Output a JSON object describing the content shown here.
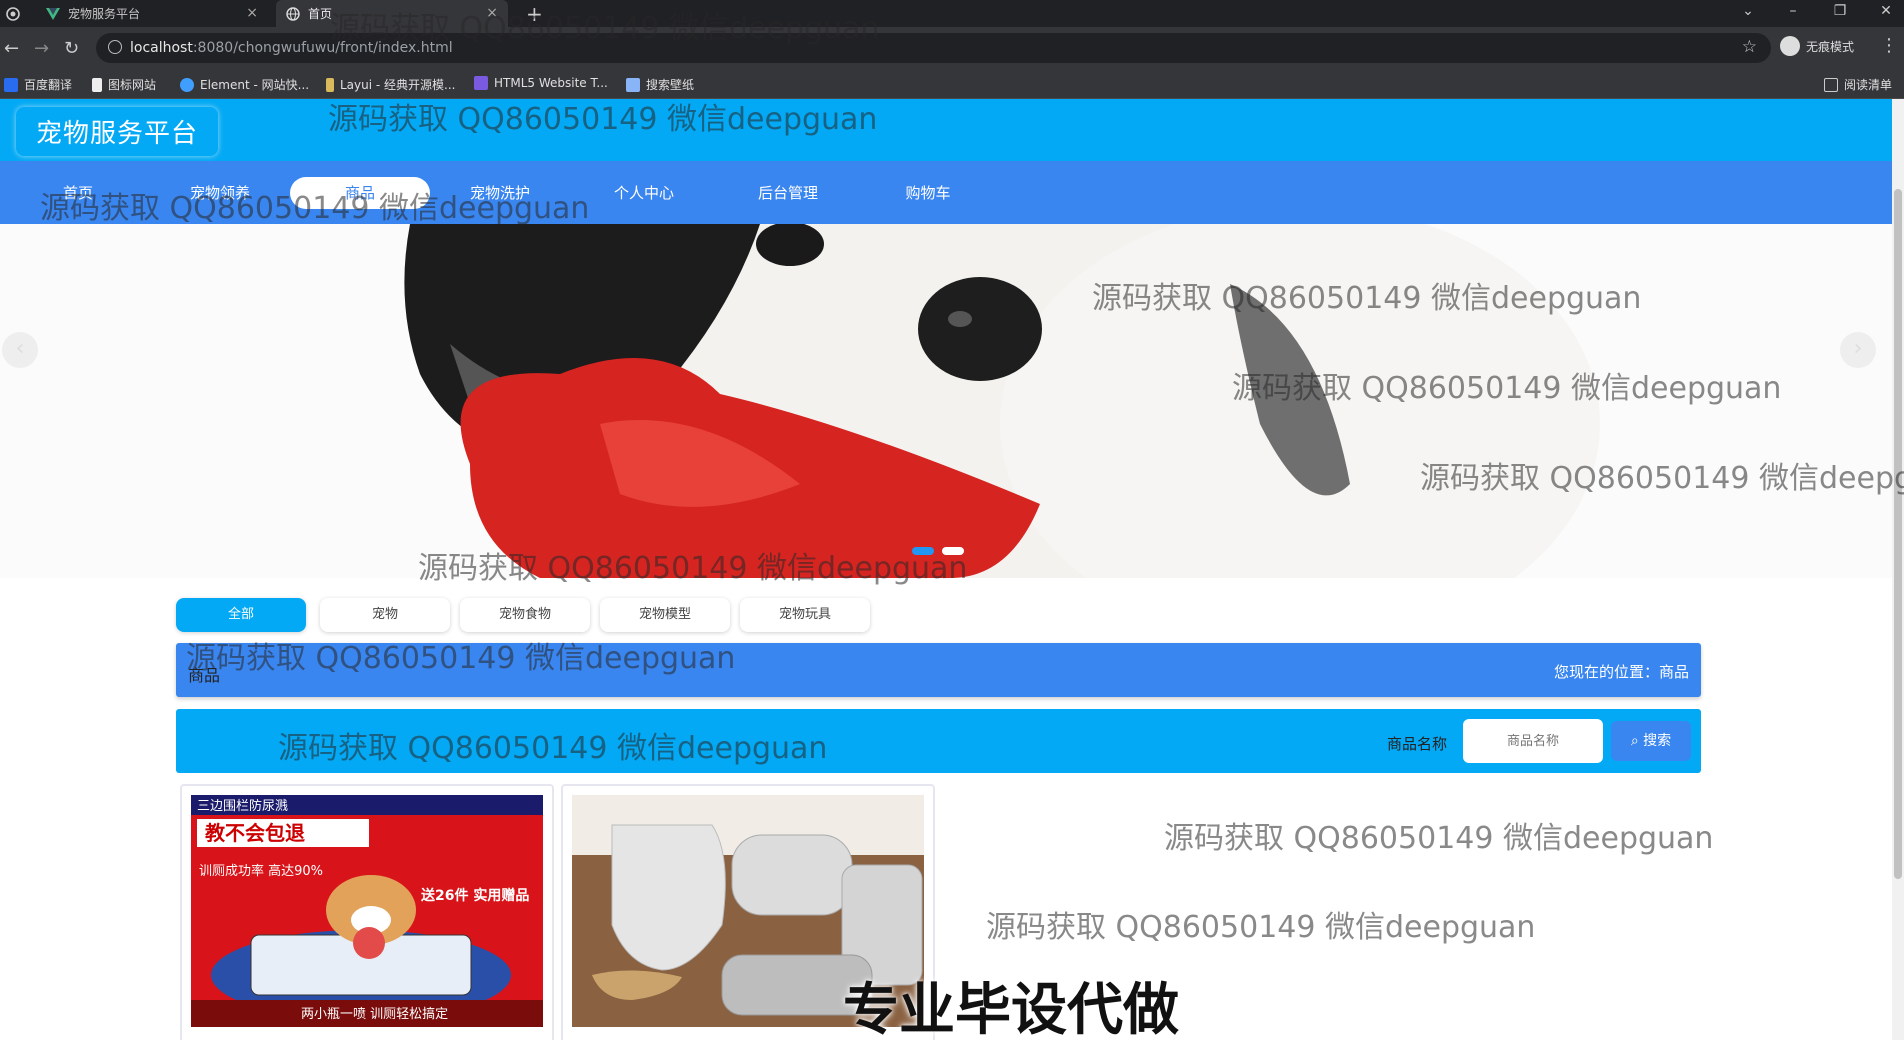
{
  "browser": {
    "tabs": [
      {
        "title": "宠物服务平台",
        "active": false
      },
      {
        "title": "首页",
        "active": true
      }
    ],
    "url_host": "localhost",
    "url_rest": ":8080/chongwufuwu/front/index.html",
    "profile_label": "无痕模式",
    "reading_list": "阅读清单",
    "bookmarks": [
      "百度翻译",
      "图标网站",
      "Element - 网站快...",
      "Layui - 经典开源模...",
      "HTML5 Website T...",
      "搜索壁纸"
    ]
  },
  "site": {
    "logo": "宠物服务平台",
    "nav": [
      {
        "label": "首页",
        "active": false
      },
      {
        "label": "宠物领养",
        "active": false
      },
      {
        "label": "商品",
        "active": true
      },
      {
        "label": "宠物洗护",
        "active": false
      },
      {
        "label": "个人中心",
        "active": false
      },
      {
        "label": "后台管理",
        "active": false
      },
      {
        "label": "购物车",
        "active": false
      }
    ],
    "banner_slide": 1,
    "banner_slide_count": 2
  },
  "categories": [
    {
      "label": "全部",
      "active": true
    },
    {
      "label": "宠物",
      "active": false
    },
    {
      "label": "宠物食物",
      "active": false
    },
    {
      "label": "宠物模型",
      "active": false
    },
    {
      "label": "宠物玩具",
      "active": false
    }
  ],
  "breadcrumb": {
    "title": "商品",
    "location": "您现在的位置：商品"
  },
  "search": {
    "label": "商品名称",
    "placeholder": "商品名称",
    "button": "搜索"
  },
  "products": [
    {
      "image_text": [
        "三边围栏防尿溅",
        "教不会包退",
        "训厕成功率 高达90%",
        "送26件 实用赠品",
        "两小瓶一喷 训厕轻松搞定"
      ]
    },
    {
      "image_text": []
    }
  ],
  "overlays": {
    "watermark": "源码获取 QQ86050149 微信deepguan",
    "bottom_banner": "专业毕设代做"
  },
  "colors": {
    "header": "#03a9f4",
    "nav": "#3a86f0",
    "accent": "#2196f3"
  }
}
